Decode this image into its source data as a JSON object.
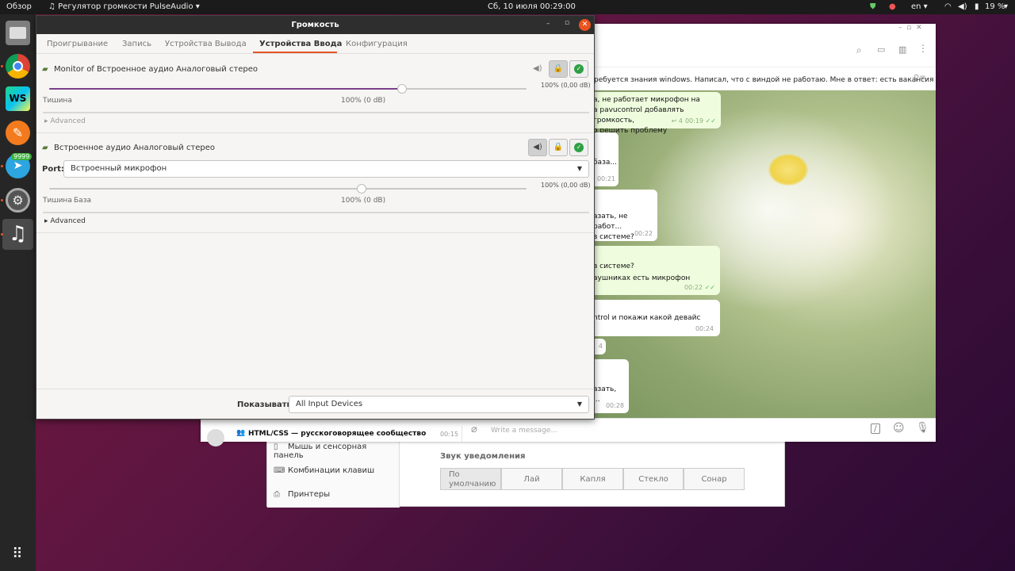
{
  "topbar": {
    "activities": "Обзор",
    "app_menu": "Регулятор громкости PulseAudio",
    "clock": "Сб, 10 июля  00:29:00",
    "lang": "en",
    "battery": "19 %"
  },
  "dock": {
    "badge": "9999",
    "ws_label": "WS"
  },
  "settings": {
    "items": [
      {
        "label": "Мышь и сенсорная панель"
      },
      {
        "label": "Комбинации клавиш"
      },
      {
        "label": "Принтеры"
      }
    ],
    "sound_title": "Звук уведомления",
    "sounds": [
      "По умолчанию",
      "Лай",
      "Капля",
      "Стекло",
      "Сонар"
    ]
  },
  "telegram": {
    "pinned": "ребуется знания windows. Написал, что с виндой не работаю. Мне в ответ: есть вакансия ...",
    "chat_item": "HTML/CSS — русскоговорящее сообщество",
    "chat_time": "00:15",
    "compose_placeholder": "Write a message...",
    "messages": [
      {
        "l1": "а, не работает микрофон на",
        "l2": "а pavucontrol добавлять громкость,",
        "l3": "о решить проблему",
        "reply": "↩ 4",
        "time": "00:19"
      },
      {
        "l1": "база...",
        "time": "00:21"
      },
      {
        "l1": "азать, не работ...",
        "l2": "в системе?",
        "time": "00:22"
      },
      {
        "l1": "в системе?",
        "l2": "аушниках есть микрофон",
        "time": "00:22"
      },
      {
        "l1": "ntrol и покажи какой девайс",
        "time": "00:24"
      },
      {
        "l1": "4"
      },
      {
        "l1": "азать, ...",
        "time": "00:28"
      }
    ]
  },
  "pavucontrol": {
    "title": "Громкость",
    "tabs": [
      "Проигрывание",
      "Запись",
      "Устройства Вывода",
      "Устройства Ввода",
      "Конфигурация"
    ],
    "devices": [
      {
        "name": "Monitor of Встроенное аудио Аналоговый стерео",
        "level": 0.74,
        "value": "100% (0,00 dB)",
        "left_label": "Тишина",
        "mid_label": "100% (0 dB)",
        "advanced": "Advanced"
      },
      {
        "name": "Встроенное аудио Аналоговый стерео",
        "port_label": "Port:",
        "port_value": "Встроенный микрофон",
        "level": 0.0,
        "value": "100% (0,00 dB)",
        "left_label": "Тишина",
        "base_label": "База",
        "mid_label": "100% (0 dB)",
        "advanced": "Advanced"
      }
    ],
    "show_label": "Показывать:",
    "show_value": "All Input Devices"
  },
  "colors": {
    "accent": "#e95420",
    "slider": "#7b3f8a",
    "ok_green": "#2ea043"
  }
}
